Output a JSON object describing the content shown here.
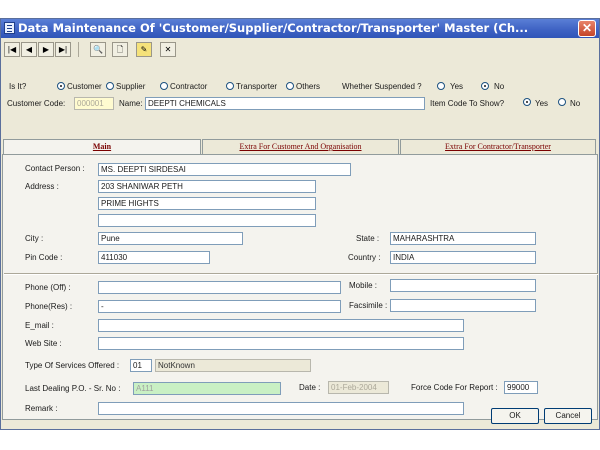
{
  "window": {
    "title": "Data Maintenance Of 'Customer/Supplier/Contractor/Transporter' Master (Ch...",
    "close": "✕"
  },
  "toolbar": {
    "first": "|◀",
    "prev": "◀",
    "next": "▶",
    "last": "▶|",
    "find": "🔍",
    "new": "🗋",
    "edit": "✎",
    "delete": "✕"
  },
  "header": {
    "is_it_label": "Is It?",
    "types": [
      "Customer",
      "Supplier",
      "Contractor",
      "Transporter",
      "Others"
    ],
    "selected_type": "Customer",
    "suspended_label": "Whether Suspended ?",
    "suspended_yes": "Yes",
    "suspended_no": "No",
    "suspended_value": "No",
    "code_label": "Customer Code:",
    "code_value": "000001",
    "name_label": "Name:",
    "name_value": "DEEPTI CHEMICALS",
    "itemcode_label": "Item Code To Show?",
    "itemcode_yes": "Yes",
    "itemcode_no": "No",
    "itemcode_value": "Yes"
  },
  "tabs": [
    "Main",
    "Extra For Customer And Organisation",
    "Extra For Contractor/Transporter"
  ],
  "main": {
    "contact_label": "Contact Person :",
    "contact": "MS. DEEPTI SIRDESAI",
    "address_label": "Address :",
    "address": [
      "203 SHANIWAR PETH",
      "PRIME HIGHTS",
      ""
    ],
    "city_label": "City :",
    "city": "Pune",
    "state_label": "State :",
    "state": "MAHARASHTRA",
    "pin_label": "Pin Code :",
    "pin": "411030",
    "country_label": "Country :",
    "country": "INDIA",
    "phone_off_label": "Phone (Off) :",
    "phone_off": "",
    "mobile_label": "Mobile :",
    "mobile": "",
    "phone_res_label": "Phone(Res) :",
    "phone_res": "-",
    "fax_label": "Facsimile :",
    "fax": "",
    "email_label": "E_mail :",
    "email": "",
    "web_label": "Web Site :",
    "web": "",
    "services_label": "Type Of Services Offered :",
    "services_code": "01",
    "services_name": "NotKnown",
    "last_po_label": "Last Dealing P.O. - Sr. No :",
    "last_po": "A111",
    "date_label": "Date :",
    "date": "01-Feb-2004",
    "force_label": "Force Code For Report :",
    "force": "99000",
    "remark_label": "Remark :",
    "remark": ""
  },
  "buttons": {
    "ok": "OK",
    "cancel": "Cancel"
  }
}
